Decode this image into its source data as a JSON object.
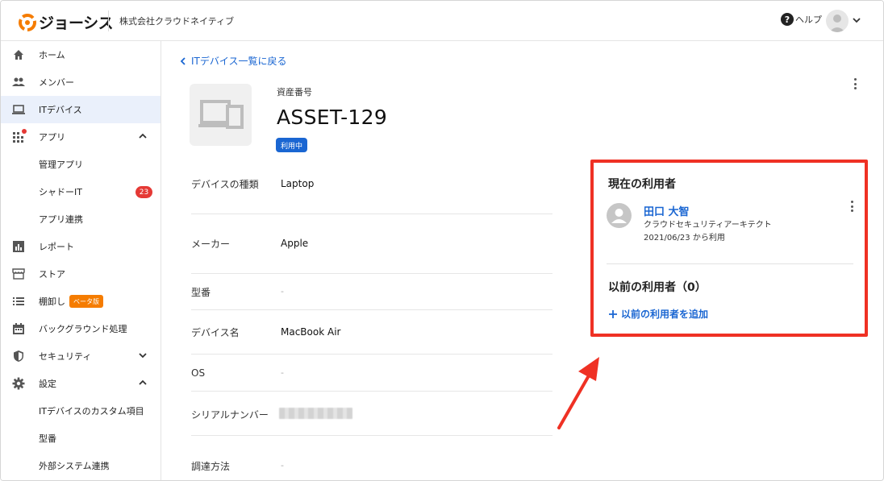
{
  "header": {
    "logo_text": "ジョーシス",
    "org_name": "株式会社クラウドネイティブ",
    "help_label": "ヘルプ",
    "help_icon_glyph": "?",
    "brand_color": "#f57c00"
  },
  "sidebar": {
    "items": [
      {
        "label": "ホーム",
        "icon": "home-icon"
      },
      {
        "label": "メンバー",
        "icon": "people-icon"
      },
      {
        "label": "ITデバイス",
        "icon": "laptop-icon",
        "active": true
      },
      {
        "label": "アプリ",
        "icon": "apps-grid-icon",
        "expanded": true
      },
      {
        "label": "管理アプリ"
      },
      {
        "label": "シャドーIT",
        "badge": "23"
      },
      {
        "label": "アプリ連携"
      },
      {
        "label": "レポート",
        "icon": "report-icon"
      },
      {
        "label": "ストア",
        "icon": "store-icon"
      },
      {
        "label": "棚卸し",
        "icon": "list-icon",
        "badge": "ベータ版"
      },
      {
        "label": "バックグラウンド処理",
        "icon": "calendar-icon"
      },
      {
        "label": "セキュリティ",
        "icon": "shield-icon",
        "expanded": false
      },
      {
        "label": "設定",
        "icon": "gear-icon",
        "expanded": true
      },
      {
        "label": "ITデバイスのカスタム項目"
      },
      {
        "label": "型番"
      },
      {
        "label": "外部システム連携"
      }
    ]
  },
  "main": {
    "back_link": "ITデバイス一覧に戻る",
    "asset_caption": "資産番号",
    "asset_number": "ASSET-129",
    "status": "利用中",
    "fields": [
      {
        "label": "デバイスの種類",
        "value": "Laptop"
      },
      {
        "label": "メーカー",
        "value": "Apple"
      },
      {
        "label": "型番",
        "value": "-"
      },
      {
        "label": "デバイス名",
        "value": "MacBook Air"
      },
      {
        "label": "OS",
        "value": "-"
      },
      {
        "label": "シリアルナンバー",
        "value": ""
      },
      {
        "label": "調達方法",
        "value": "-"
      }
    ]
  },
  "users_card": {
    "current_title": "現在の利用者",
    "user_name": "田口 大智",
    "user_role": "クラウドセキュリティアーキテクト",
    "user_since": "2021/06/23 から利用",
    "previous_title": "以前の利用者（0）",
    "add_previous": "以前の利用者を追加",
    "highlight_color": "#ef3124"
  }
}
